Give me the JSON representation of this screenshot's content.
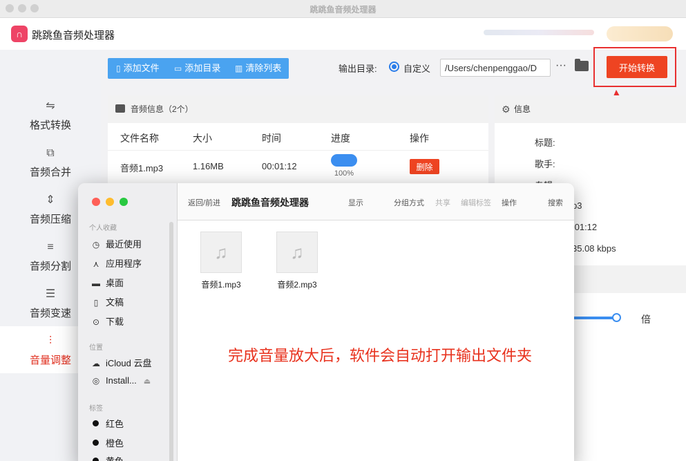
{
  "window": {
    "title": "跳跳鱼音频处理器"
  },
  "app": {
    "name": "跳跳鱼音频处理器",
    "logo_icon": "headphones-icon"
  },
  "sidebar": {
    "items": [
      {
        "label": "格式转换",
        "icon": "format-convert-icon",
        "active": false
      },
      {
        "label": "音频合并",
        "icon": "merge-icon",
        "active": false
      },
      {
        "label": "音频压缩",
        "icon": "compress-icon",
        "active": false
      },
      {
        "label": "音频分割",
        "icon": "split-icon",
        "active": false
      },
      {
        "label": "音频变速",
        "icon": "speed-icon",
        "active": false
      },
      {
        "label": "音量调整",
        "icon": "volume-adjust-icon",
        "active": true
      }
    ]
  },
  "toolbar": {
    "add_file": "添加文件",
    "add_folder": "添加目录",
    "clear_list": "清除列表",
    "output_label": "输出目录:",
    "output_option": "自定义",
    "output_path": "/Users/chenpenggao/D",
    "more": "···",
    "start": "开始转换"
  },
  "file_list": {
    "title": "音频信息（2个）",
    "columns": [
      "文件名称",
      "大小",
      "时间",
      "进度",
      "操作"
    ],
    "rows": [
      {
        "name": "音频1.mp3",
        "size": "1.16MB",
        "time": "00:01:12",
        "progress_percent": 100,
        "progress_text": "100%",
        "action": "删除"
      }
    ]
  },
  "info": {
    "title": "信息",
    "labels": [
      "标题:",
      "歌手:",
      "专辑:"
    ],
    "values": [
      "p3",
      ":01:12",
      "35.08 kbps"
    ],
    "volume_unit": "倍"
  },
  "finder": {
    "title": "跳跳鱼音频处理器",
    "nav": "返回/前进",
    "toolbar": [
      "显示",
      "分组方式",
      "共享",
      "编辑标签",
      "操作",
      "搜索"
    ],
    "sections": {
      "favorites": "个人收藏",
      "locations": "位置",
      "tags": "标签"
    },
    "favorites": [
      "最近使用",
      "应用程序",
      "桌面",
      "文稿",
      "下载"
    ],
    "locations": [
      "iCloud 云盘",
      "Install..."
    ],
    "tags": [
      "红色",
      "橙色",
      "黄色"
    ],
    "files": [
      "音频1.mp3",
      "音频2.mp3"
    ]
  },
  "notice": "完成音量放大后，软件会自动打开输出文件夹",
  "colors": {
    "accent_red": "#ee4422",
    "accent_blue": "#4aa3f0",
    "annotation_red": "#e8321e"
  }
}
